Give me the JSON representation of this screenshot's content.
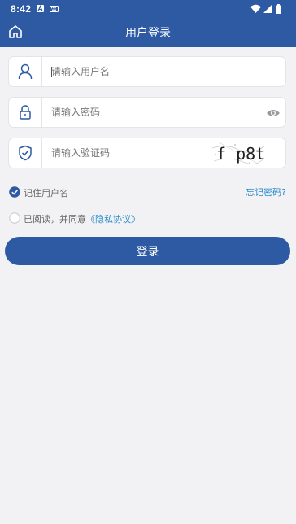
{
  "status_bar": {
    "time": "8:42",
    "icons": [
      "a-notification-icon",
      "keyboard-icon",
      "wifi-icon",
      "signal-icon",
      "battery-icon"
    ]
  },
  "header": {
    "title": "用户登录",
    "home_icon": "home-icon",
    "background": "#2d5aa3"
  },
  "form": {
    "username": {
      "placeholder": "请输入用户名",
      "value": "",
      "icon": "user-icon"
    },
    "password": {
      "placeholder": "请输入密码",
      "value": "",
      "icon": "lock-icon",
      "toggle_icon": "eye-icon"
    },
    "captcha": {
      "placeholder": "请输入验证码",
      "value": "",
      "icon": "shield-check-icon",
      "image_text": "f p8t"
    }
  },
  "remember": {
    "label": "记住用户名",
    "checked": true
  },
  "forgot_label": "忘记密码?",
  "agreement": {
    "checked": false,
    "prefix": "已阅读，并同意",
    "link": "《隐私协议》"
  },
  "login_label": "登录",
  "colors": {
    "primary": "#2d5aa3",
    "link": "#2a8bc9",
    "page_bg": "#f2f2f4"
  }
}
